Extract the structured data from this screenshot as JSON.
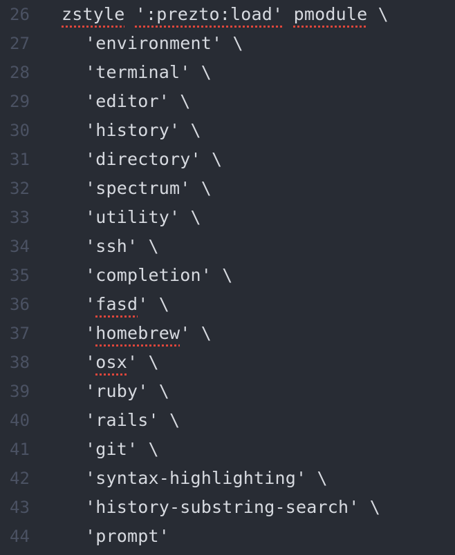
{
  "editor": {
    "colors": {
      "background": "#282c34",
      "text": "#d7dae0",
      "gutter": "#4b5263",
      "spellcheck_underline": "#e0463b"
    },
    "first_line": {
      "number": "26",
      "keyword": "zstyle",
      "space1": " ",
      "context": "':prezto:load'",
      "space2": " ",
      "arg": "pmodule",
      "cont": " \\"
    },
    "lines": [
      {
        "number": "27",
        "pre": "'",
        "name": "environment",
        "post": "' \\",
        "misspelled": false
      },
      {
        "number": "28",
        "pre": "'",
        "name": "terminal",
        "post": "' \\",
        "misspelled": false
      },
      {
        "number": "29",
        "pre": "'",
        "name": "editor",
        "post": "' \\",
        "misspelled": false
      },
      {
        "number": "30",
        "pre": "'",
        "name": "history",
        "post": "' \\",
        "misspelled": false
      },
      {
        "number": "31",
        "pre": "'",
        "name": "directory",
        "post": "' \\",
        "misspelled": false
      },
      {
        "number": "32",
        "pre": "'",
        "name": "spectrum",
        "post": "' \\",
        "misspelled": false
      },
      {
        "number": "33",
        "pre": "'",
        "name": "utility",
        "post": "' \\",
        "misspelled": false
      },
      {
        "number": "34",
        "pre": "'",
        "name": "ssh",
        "post": "' \\",
        "misspelled": false
      },
      {
        "number": "35",
        "pre": "'",
        "name": "completion",
        "post": "' \\",
        "misspelled": false
      },
      {
        "number": "36",
        "pre": "'",
        "name": "fasd",
        "post": "' \\",
        "misspelled": true
      },
      {
        "number": "37",
        "pre": "'",
        "name": "homebrew",
        "post": "' \\",
        "misspelled": true
      },
      {
        "number": "38",
        "pre": "'",
        "name": "osx",
        "post": "' \\",
        "misspelled": true
      },
      {
        "number": "39",
        "pre": "'",
        "name": "ruby",
        "post": "' \\",
        "misspelled": false
      },
      {
        "number": "40",
        "pre": "'",
        "name": "rails",
        "post": "' \\",
        "misspelled": false
      },
      {
        "number": "41",
        "pre": "'",
        "name": "git",
        "post": "' \\",
        "misspelled": false
      },
      {
        "number": "42",
        "pre": "'",
        "name": "syntax-highlighting",
        "post": "' \\",
        "misspelled": false
      },
      {
        "number": "43",
        "pre": "'",
        "name": "history-substring-search",
        "post": "' \\",
        "misspelled": false
      },
      {
        "number": "44",
        "pre": "'",
        "name": "prompt",
        "post": "'",
        "misspelled": false
      }
    ]
  }
}
